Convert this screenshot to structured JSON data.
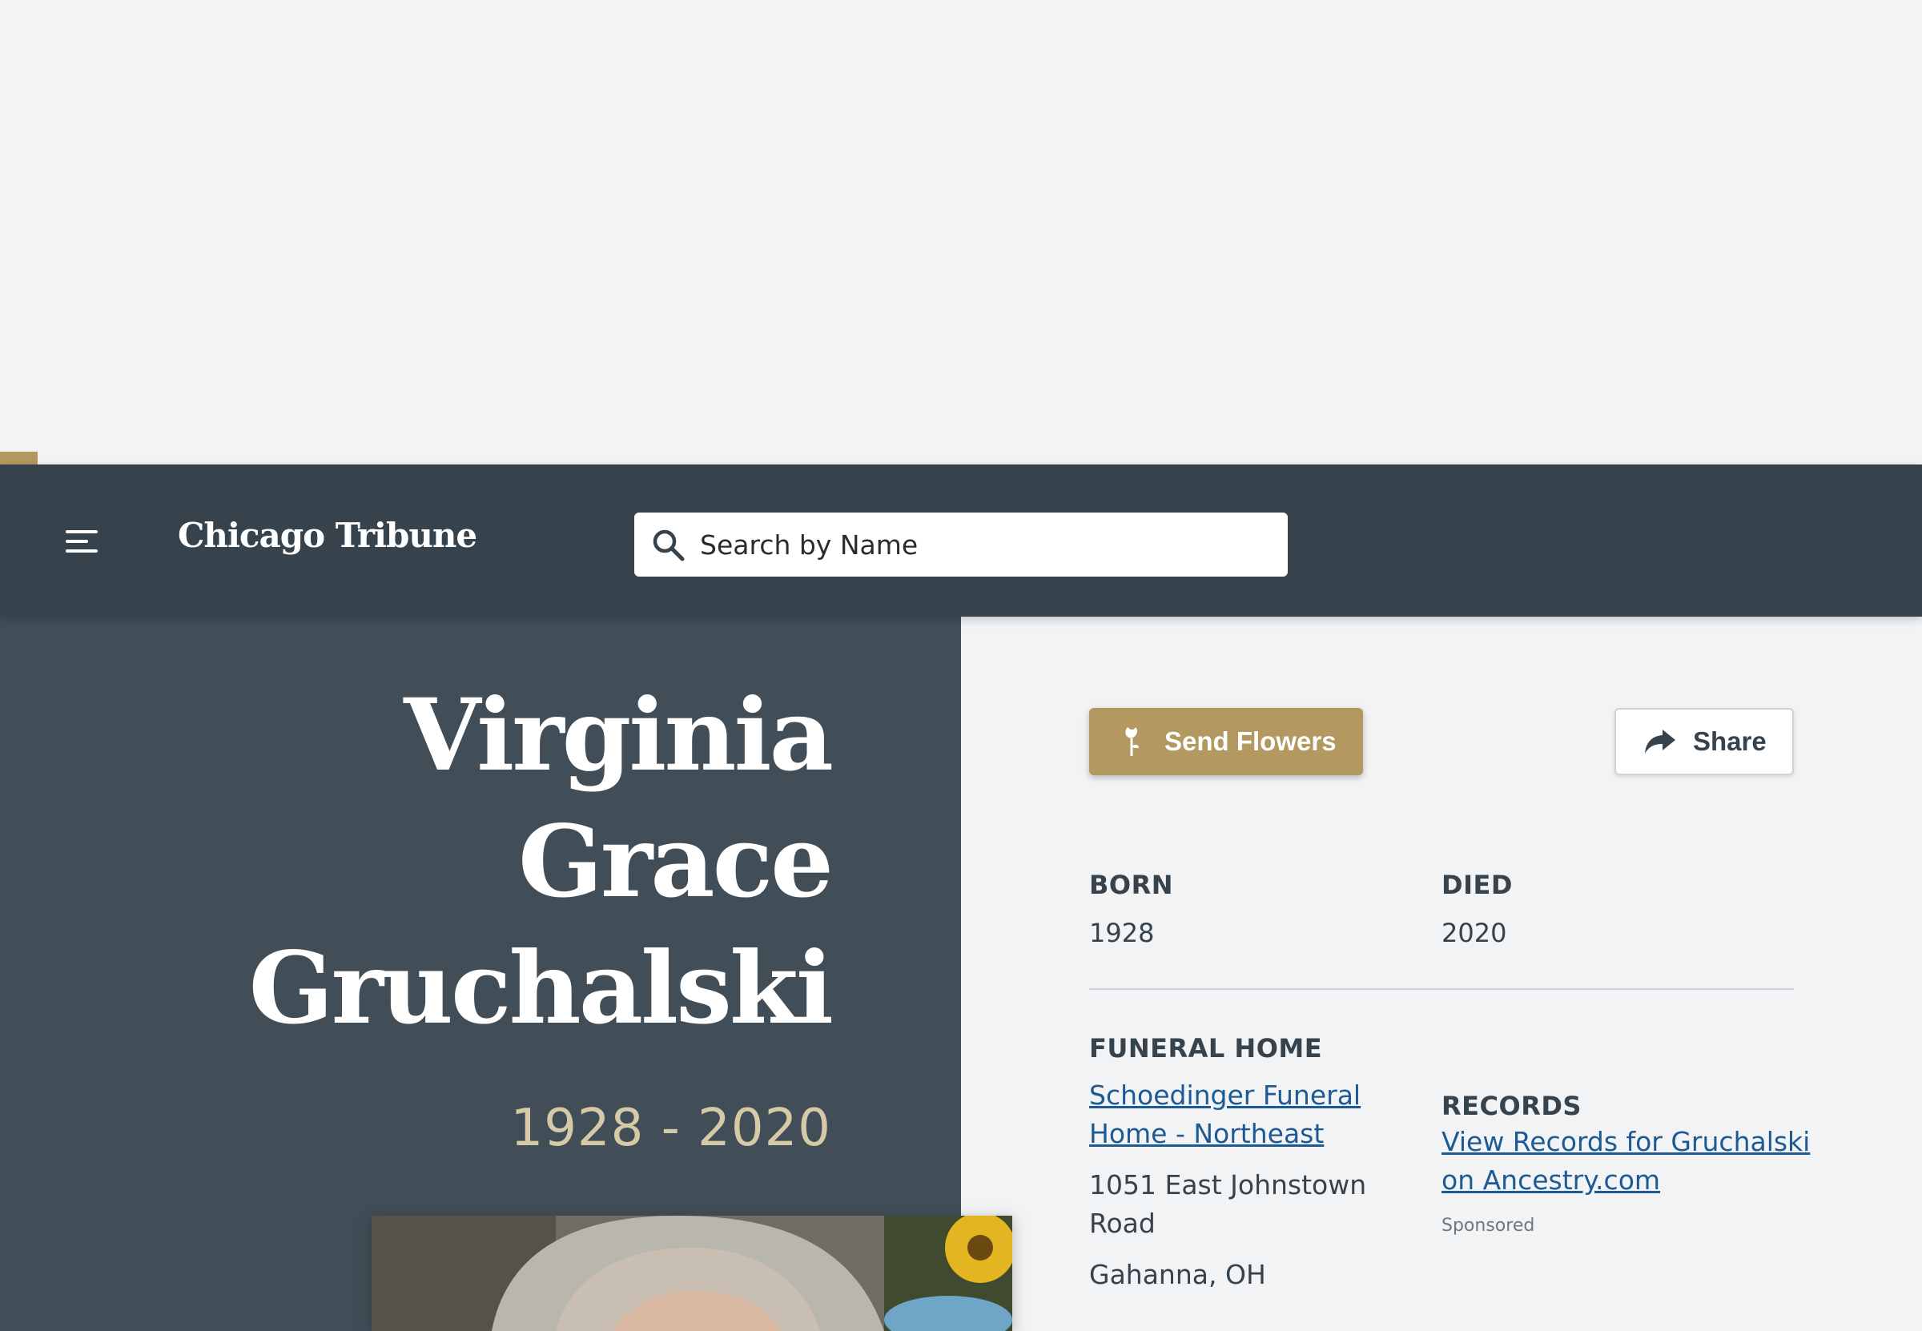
{
  "header": {
    "logo_text": "Chicago Tribune",
    "search_placeholder": "Search by Name"
  },
  "obituary": {
    "name_lines": [
      "Virginia",
      "Grace",
      "Gruchalski"
    ],
    "dates": "1928 - 2020"
  },
  "actions": {
    "send_flowers_label": "Send Flowers",
    "share_label": "Share"
  },
  "details": {
    "born_label": "BORN",
    "born_value": "1928",
    "died_label": "DIED",
    "died_value": "2020",
    "funeral_home_label": "FUNERAL HOME",
    "funeral_home_name_lines": [
      "Schoedinger Funeral",
      "Home - Northeast"
    ],
    "address_lines": [
      "1051 East Johnstown",
      "Road"
    ],
    "city": "Gahanna, OH",
    "records_label": "RECORDS",
    "records_link_lines": [
      "View Records for Gruchalski",
      "on Ancestry.com"
    ],
    "sponsored": "Sponsored"
  },
  "icons": {
    "menu": "hamburger-icon",
    "search": "search-icon",
    "flowers": "rose-icon",
    "share": "share-arrow-icon"
  },
  "colors": {
    "header_bg": "#36434d",
    "left_panel_bg": "#424e57",
    "accent_gold": "#b39860",
    "link_blue": "#1d5a93"
  }
}
